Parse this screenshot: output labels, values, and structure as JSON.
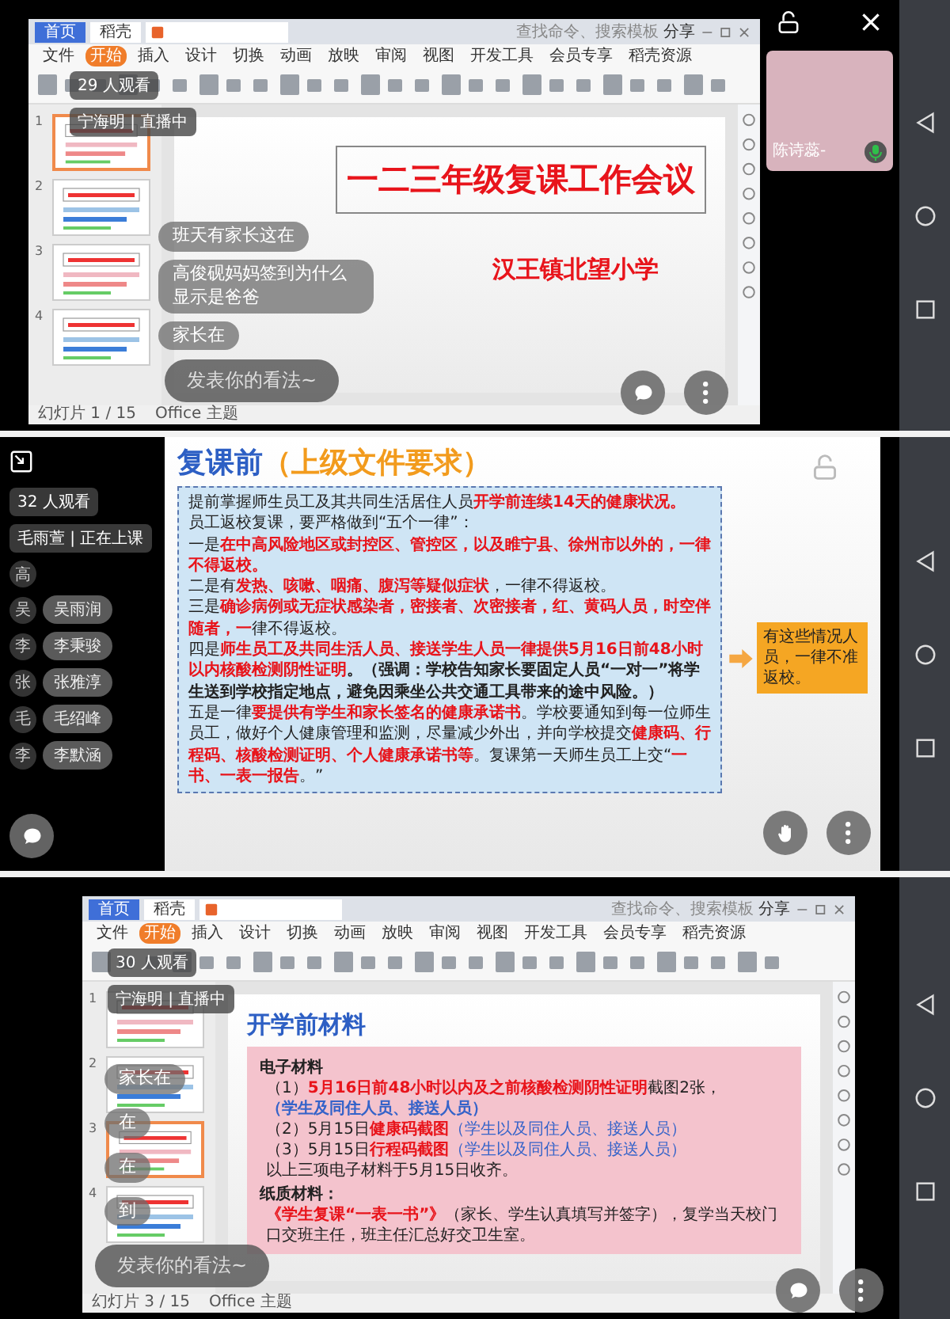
{
  "panels": [
    {
      "kind": "presentation",
      "tabs": [
        "首页",
        "稻壳"
      ],
      "search_placeholder": "查找命令、搜索模板",
      "share": "分享",
      "menu": [
        {
          "label": "文件",
          "selected": false
        },
        {
          "label": "开始",
          "selected": true
        },
        {
          "label": "插入",
          "selected": false
        },
        {
          "label": "设计",
          "selected": false
        },
        {
          "label": "切换",
          "selected": false
        },
        {
          "label": "动画",
          "selected": false
        },
        {
          "label": "放映",
          "selected": false
        },
        {
          "label": "审阅",
          "selected": false
        },
        {
          "label": "视图",
          "selected": false
        },
        {
          "label": "开发工具",
          "selected": false
        },
        {
          "label": "会员专享",
          "selected": false
        },
        {
          "label": "稻壳资源",
          "selected": false
        }
      ],
      "thumbnails": [
        {
          "number": "1",
          "selected": true
        },
        {
          "number": "2",
          "selected": false
        },
        {
          "number": "3",
          "selected": false
        },
        {
          "number": "4",
          "selected": false
        }
      ],
      "slide": {
        "kind": "cover",
        "title": "一二三年级复课工作会议",
        "subtitle": "汉王镇北望小学"
      },
      "status": {
        "page": "幻灯片 1 / 15",
        "theme": "Office 主题"
      },
      "viewers": "29 人观看",
      "host": "宁海明 | 直播中",
      "comments": [
        "班天有家长这在",
        "高俊砚妈妈签到为什么显示是爸爸",
        "家长在"
      ],
      "comment_placeholder": "发表你的看法~",
      "guest_video": {
        "name": "陈诗蕊-"
      }
    },
    {
      "kind": "fullscreen-slide",
      "viewers": "32 人观看",
      "host": "毛雨萱 | 正在上课",
      "participants": [
        {
          "initial": "高"
        },
        {
          "initial": "吴",
          "comment": "吴雨润"
        },
        {
          "initial": "李",
          "comment": "李秉骏"
        },
        {
          "initial": "张",
          "comment": "张雅淳"
        },
        {
          "initial": "毛",
          "comment": "毛绍峰"
        },
        {
          "initial": "李",
          "comment": "李默涵"
        }
      ],
      "slide": {
        "kind": "requirements",
        "title": "复课前",
        "title_note": "（上级文件要求）",
        "callout": "有这些情况人员，一律不准返校。",
        "paragraphs": [
          [
            {
              "kind": "plain",
              "text": "提前掌握师生员工及其共同生活居住人员"
            },
            {
              "kind": "alert",
              "text": "开学前连续14天的健康状况。"
            }
          ],
          [
            {
              "kind": "plain",
              "text": "员工返校复课，要严格做到“五个一律”："
            }
          ],
          [
            {
              "kind": "plain",
              "text": "一是"
            },
            {
              "kind": "alert",
              "text": "在中高风险地区或封控区、管控区，以及睢宁县、徐州市以外的，一律不得返校。"
            }
          ],
          [
            {
              "kind": "plain",
              "text": "二是有"
            },
            {
              "kind": "alert",
              "text": "发热、咳嗽、咽痛、腹泻等疑似症状"
            },
            {
              "kind": "plain",
              "text": "，一律不得返校。"
            }
          ],
          [
            {
              "kind": "plain",
              "text": "三是"
            },
            {
              "kind": "alert",
              "text": "确诊病例或无症状感染者，密接者、次密接者，红、黄码人员，时空伴随者，一"
            },
            {
              "kind": "plain",
              "text": "律不得返校。"
            }
          ],
          [
            {
              "kind": "plain",
              "text": "四是"
            },
            {
              "kind": "alert",
              "text": "师生员工及共同生活人员、接送学生人员一律提供5月16日前48小时以内核酸检测阴性证明"
            },
            {
              "kind": "stress",
              "text": "。（强调：学校告知家长要固定人员“一对一”将学生送到学校指定地点，避免因乘坐公共交通工具带来的途中风险。）"
            }
          ],
          [
            {
              "kind": "plain",
              "text": "五是一律"
            },
            {
              "kind": "alert",
              "text": "要提供有学生和家长签名的健康承诺书"
            },
            {
              "kind": "plain",
              "text": "。学校要通知到每一位师生员工，做好个人健康管理和监测，尽量减少外出，并向学校提交"
            },
            {
              "kind": "alert",
              "text": "健康码、行程码、核酸检测证明、个人健康承诺书等"
            },
            {
              "kind": "plain",
              "text": "。复课第一天师生员工上交“"
            },
            {
              "kind": "alert",
              "text": "一书、一表一报告"
            },
            {
              "kind": "plain",
              "text": "。”"
            }
          ]
        ]
      }
    },
    {
      "kind": "presentation",
      "tabs": [
        "首页",
        "稻壳"
      ],
      "search_placeholder": "查找命令、搜索模板",
      "share": "分享",
      "menu": [
        {
          "label": "文件",
          "selected": false
        },
        {
          "label": "开始",
          "selected": true
        },
        {
          "label": "插入",
          "selected": false
        },
        {
          "label": "设计",
          "selected": false
        },
        {
          "label": "切换",
          "selected": false
        },
        {
          "label": "动画",
          "selected": false
        },
        {
          "label": "放映",
          "selected": false
        },
        {
          "label": "审阅",
          "selected": false
        },
        {
          "label": "视图",
          "selected": false
        },
        {
          "label": "开发工具",
          "selected": false
        },
        {
          "label": "会员专享",
          "selected": false
        },
        {
          "label": "稻壳资源",
          "selected": false
        }
      ],
      "thumbnails": [
        {
          "number": "1",
          "selected": false
        },
        {
          "number": "2",
          "selected": false
        },
        {
          "number": "3",
          "selected": true
        },
        {
          "number": "4",
          "selected": false
        }
      ],
      "slide": {
        "kind": "materials",
        "title": "开学前材料",
        "sections": [
          {
            "heading": "电子材料",
            "lines": [
              [
                {
                  "kind": "plain",
                  "text": "（1）"
                },
                {
                  "kind": "alert",
                  "text": "5月16日前48小时以内及之前核酸检测阴性证明"
                },
                {
                  "kind": "plain",
                  "text": "截图2张，"
                }
              ],
              [
                {
                  "kind": "note",
                  "text": "**（学生及同住人员、接送人员）**"
                }
              ],
              [
                {
                  "kind": "plain",
                  "text": "（2）5月15日"
                },
                {
                  "kind": "alert",
                  "text": "健康码截图"
                },
                {
                  "kind": "note",
                  "text": "（学生以及同住人员、接送人员）"
                }
              ],
              [
                {
                  "kind": "plain",
                  "text": "（3）5月15日"
                },
                {
                  "kind": "alert",
                  "text": "行程码截图"
                },
                {
                  "kind": "note",
                  "text": "（学生以及同住人员、接送人员）"
                }
              ],
              [
                {
                  "kind": "plain",
                  "text": "以上三项电子材料于5月15日收齐。"
                }
              ]
            ]
          },
          {
            "heading": "纸质材料：",
            "lines": [
              [
                {
                  "kind": "alert",
                  "text": "《学生复课“一表一书”》"
                },
                {
                  "kind": "plain",
                  "text": "（家长、学生认真填写并签字），复学当天校门口交班主任，班主任汇总好交卫生室。"
                }
              ]
            ]
          }
        ]
      },
      "status": {
        "page": "幻灯片 3 / 15",
        "theme": "Office 主题"
      },
      "viewers": "30 人观看",
      "host": "宁海明 | 直播中",
      "comments": [
        "家长在",
        "在",
        "在",
        "到"
      ],
      "comment_placeholder": "发表你的看法~"
    }
  ]
}
